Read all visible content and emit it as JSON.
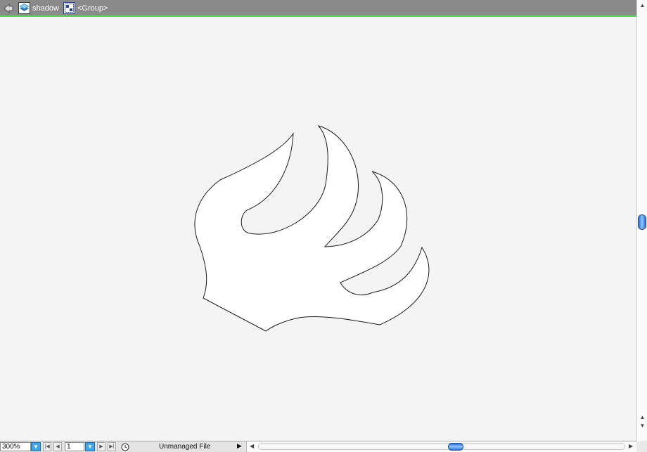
{
  "breadcrumb": {
    "layer_label": "shadow",
    "group_label": "<Group>",
    "layer_icon": "layer-thumbnail-icon",
    "group_icon": "group-icon",
    "back_icon": "back-arrow-icon"
  },
  "colors": {
    "topbar_bg": "#8a8a8a",
    "isolation_line": "#5fd35f",
    "canvas_bg": "#f4f4f4",
    "artwork_fill": "#ffffff",
    "artwork_stroke": "#1a1a1a",
    "accent": "#3fa6e8"
  },
  "status_bar": {
    "zoom_value": "300%",
    "page_value": "1",
    "status_text": "Unmanaged File",
    "first_icon": "first-page-icon",
    "prev_icon": "prev-page-icon",
    "next_icon": "next-page-icon",
    "last_icon": "last-page-icon",
    "zoom_dropdown_icon": "chevron-down-icon"
  },
  "scrollbars": {
    "up_glyph": "▲",
    "down_glyph": "▼",
    "left_glyph": "◀",
    "right_glyph": "▶"
  }
}
